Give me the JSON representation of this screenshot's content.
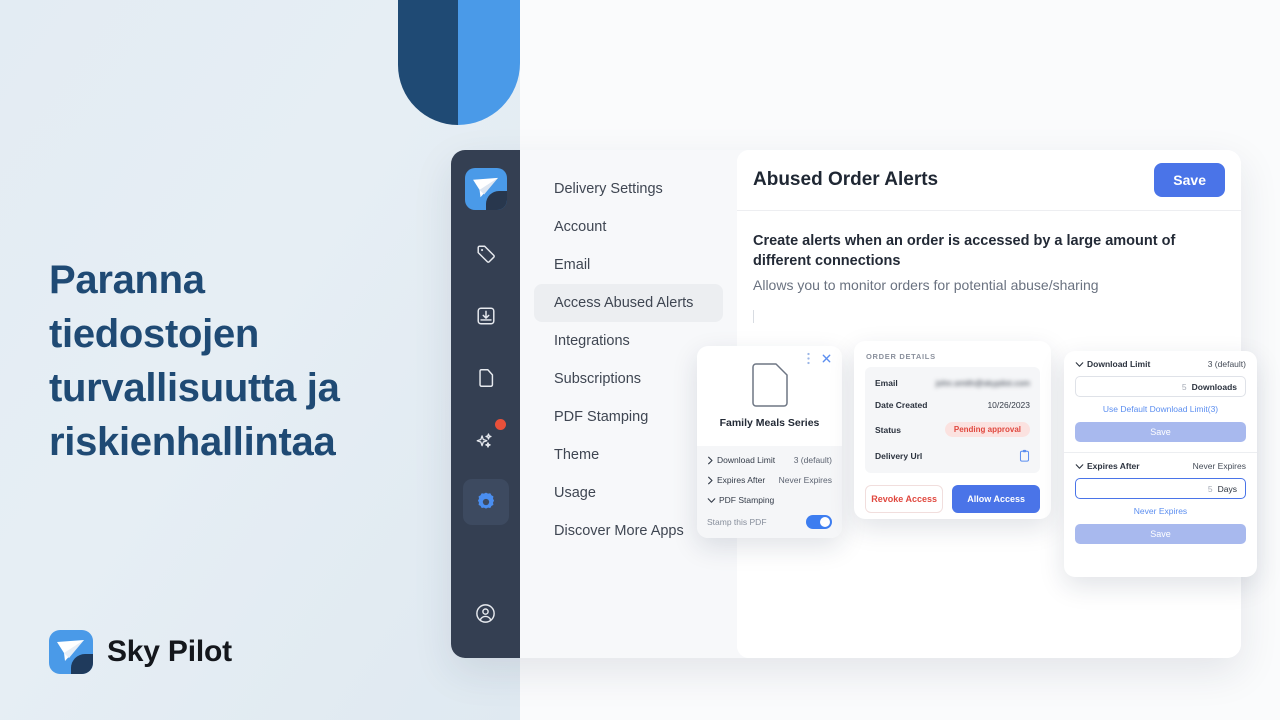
{
  "hero": {
    "title": "Paranna tiedostojen turvallisuutta ja riskienhallintaa",
    "brand_name": "Sky Pilot",
    "title_color": "#1f4a74"
  },
  "rail": {
    "items": [
      {
        "icon": "sky-pilot-logo-icon",
        "label": "Sky Pilot",
        "active": false,
        "badge": false
      },
      {
        "icon": "tag-icon",
        "label": "Tags",
        "active": false,
        "badge": false
      },
      {
        "icon": "inbox-download-icon",
        "label": "Downloads",
        "active": false,
        "badge": false
      },
      {
        "icon": "document-icon",
        "label": "Files",
        "active": false,
        "badge": false
      },
      {
        "icon": "sparkles-icon",
        "label": "What's New",
        "active": false,
        "badge": true
      },
      {
        "icon": "gear-icon",
        "label": "Settings",
        "active": true,
        "badge": false
      },
      {
        "icon": "user-circle-icon",
        "label": "Account",
        "active": false,
        "badge": false
      }
    ],
    "active_color": "#4a8ef0",
    "badge_color": "#e8503a"
  },
  "nav": {
    "items": [
      {
        "label": "Delivery Settings",
        "active": false
      },
      {
        "label": "Account",
        "active": false
      },
      {
        "label": "Email",
        "active": false
      },
      {
        "label": "Access Abused Alerts",
        "active": true
      },
      {
        "label": "Integrations",
        "active": false
      },
      {
        "label": "Subscriptions",
        "active": false
      },
      {
        "label": "PDF Stamping",
        "active": false
      },
      {
        "label": "Theme",
        "active": false
      },
      {
        "label": "Usage",
        "active": false
      },
      {
        "label": "Discover More Apps",
        "active": false
      }
    ]
  },
  "main": {
    "title": "Abused Order Alerts",
    "save_label": "Save",
    "save_color": "#4a74e8",
    "description_title": "Create alerts when an order is accessed by a large amount of different connections",
    "description_sub": "Allows you to monitor orders for potential abuse/sharing"
  },
  "card_file": {
    "file_name": "Family Meals Series",
    "kebab_icon": "kebab-menu-icon",
    "close_icon": "close-icon",
    "doc_icon": "document-icon",
    "rows": [
      {
        "label": "Download Limit",
        "value": "3 (default)",
        "chevron": "chevron-right-icon"
      },
      {
        "label": "Expires After",
        "value": "Never Expires",
        "chevron": "chevron-right-icon"
      },
      {
        "label": "PDF Stamping",
        "value": "",
        "chevron": "chevron-down-icon"
      }
    ],
    "toggle_label": "Stamp this PDF",
    "toggle_on": true,
    "toggle_color": "#3d7df0"
  },
  "card_order": {
    "section_title": "ORDER DETAILS",
    "rows": [
      {
        "label": "Email",
        "value": "john.smith@skypilot.com",
        "type": "blurred"
      },
      {
        "label": "Date Created",
        "value": "10/26/2023",
        "type": "text"
      },
      {
        "label": "Status",
        "value": "Pending approval",
        "type": "badge"
      },
      {
        "label": "Delivery Url",
        "value": "",
        "type": "copy-icon"
      }
    ],
    "revoke_label": "Revoke Access",
    "allow_label": "Allow Access",
    "badge_color": "#e0483f",
    "allow_color": "#4a74e8"
  },
  "card_limits": {
    "sections": [
      {
        "label": "Download Limit",
        "value": "3 (default)",
        "chevron": "chevron-down-icon",
        "input_value": "5",
        "input_suffix": "Downloads",
        "focused": false,
        "link": "Use Default Download Limit(3)",
        "save_label": "Save"
      },
      {
        "label": "Expires After",
        "value": "Never Expires",
        "chevron": "chevron-down-icon",
        "input_value": "5",
        "input_suffix": "Days",
        "focused": true,
        "link": "Never Expires",
        "save_label": "Save"
      }
    ],
    "link_color": "#5b8ef0",
    "save_color": "#a8b9ee"
  }
}
